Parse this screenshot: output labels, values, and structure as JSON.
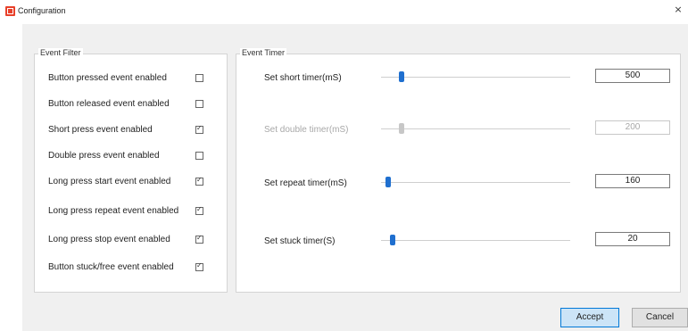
{
  "window": {
    "title": "Configuration",
    "close_glyph": "×"
  },
  "event_filter": {
    "title": "Event Filter",
    "items": [
      {
        "label": "Button pressed event enabled",
        "checked": false
      },
      {
        "label": "Button released event enabled",
        "checked": false
      },
      {
        "label": "Short press event enabled",
        "checked": true
      },
      {
        "label": "Double press event enabled",
        "checked": false
      },
      {
        "label": "Long press start event enabled",
        "checked": true
      },
      {
        "label": "Long press repeat event enabled",
        "checked": true
      },
      {
        "label": "Long press stop event enabled",
        "checked": true
      },
      {
        "label": "Button stuck/free event enabled",
        "checked": true
      }
    ]
  },
  "event_timer": {
    "title": "Event Timer",
    "rows": [
      {
        "label": "Set short timer(mS)",
        "value": "500",
        "slider_fraction": 0.11,
        "enabled": true
      },
      {
        "label": "Set double timer(mS)",
        "value": "200",
        "slider_fraction": 0.11,
        "enabled": false
      },
      {
        "label": "Set repeat timer(mS)",
        "value": "160",
        "slider_fraction": 0.04,
        "enabled": true
      },
      {
        "label": "Set stuck timer(S)",
        "value": "20",
        "slider_fraction": 0.06,
        "enabled": true
      }
    ]
  },
  "buttons": {
    "accept_label": "Accept",
    "cancel_label": "Cancel"
  },
  "colors": {
    "slider_thumb": "#1f6fcf",
    "accent": "#0078d7",
    "app_icon": "#e8402a"
  }
}
